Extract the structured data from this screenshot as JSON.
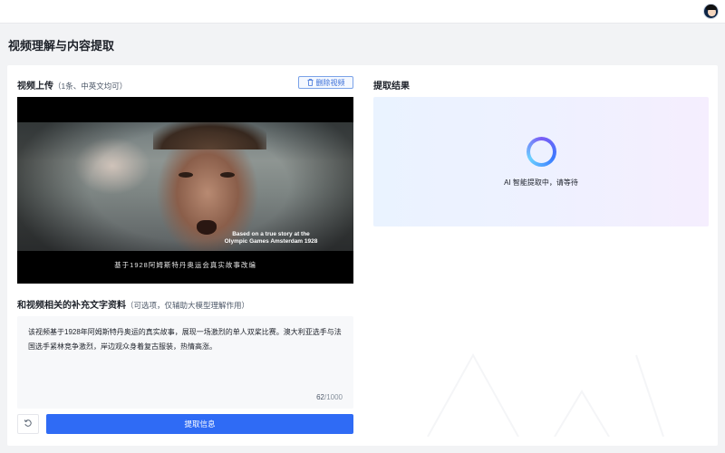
{
  "header": {
    "avatar_icon": "user-avatar-icon"
  },
  "page": {
    "title": "视频理解与内容提取"
  },
  "upload": {
    "title": "视频上传",
    "hint": "（1条、中英文均可）",
    "delete_label": "删除视频",
    "delete_icon": "trash-icon",
    "video": {
      "caption_en_line1": "Based on a true story at the",
      "caption_en_line2": "Olympic Games Amsterdam 1928",
      "caption_zh": "基于1928阿姆斯特丹奥运会真实故事改编"
    }
  },
  "supplement": {
    "title": "和视频相关的补充文字资料",
    "hint": "（可选项，仅辅助大模型理解作用）",
    "text": "该视频基于1928年阿姆斯特丹奥运的真实故事，展现一场激烈的单人双桨比赛。澳大利亚选手与法国选手紧林竞争激烈，岸边观众身着复古服装，热情高涨。",
    "count": "62",
    "max": "/1000"
  },
  "actions": {
    "reset_icon": "reset-icon",
    "submit_label": "提取信息"
  },
  "result": {
    "title": "提取结果",
    "status": "AI 智能提取中，请等待"
  },
  "colors": {
    "primary": "#2f6bf5",
    "page_bg": "#f2f3f5",
    "text": "#1d2129"
  }
}
